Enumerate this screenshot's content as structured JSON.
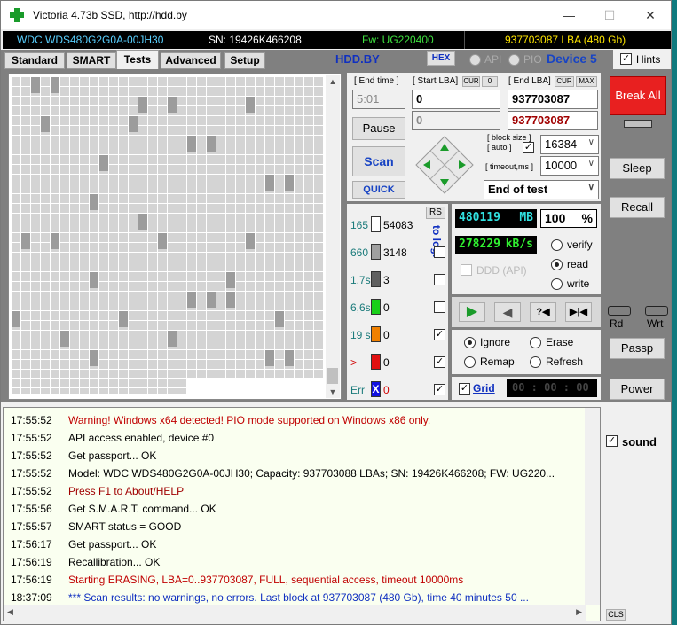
{
  "window": {
    "title": "Victoria 4.73b SSD, http://hdd.by",
    "minimize": "—",
    "maximize": "☐",
    "close": "✕"
  },
  "info": {
    "model": "WDC WDS480G2G0A-00JH30",
    "sn": "SN: 19426K466208",
    "fw": "Fw: UG220400",
    "lba": "937703087 LBA (480 Gb)"
  },
  "tabs": [
    "Standard",
    "SMART",
    "Tests",
    "Advanced",
    "Setup"
  ],
  "toolbar": {
    "hddby": "HDD.BY",
    "hex": "HEX",
    "api": "API",
    "pio": "PIO",
    "device": "Device 5",
    "hints": "Hints"
  },
  "scan": {
    "end_time_label": "[ End time ]",
    "end_time": "5:01",
    "start_lba_label": "[ Start LBA]",
    "cur": "CUR",
    "zero": "0",
    "start_lba": "0",
    "start_lba_current": "0",
    "end_lba_label": "[ End LBA]",
    "cur2": "CUR",
    "max": "MAX",
    "end_lba": "937703087",
    "end_lba_current": "937703087",
    "pause": "Pause",
    "scan": "Scan",
    "quick": "QUICK",
    "block_size_label": "[ block size ]",
    "auto_label": "[ auto ]",
    "block_size": "16384",
    "timeout_label": "[ timeout,ms ]",
    "timeout": "10000",
    "end_action": "End of test"
  },
  "stats": {
    "rs": "RS",
    "to_log": "to log:",
    "rows": [
      {
        "label": "165",
        "count": "54083",
        "color": "#ffffff"
      },
      {
        "label": "660",
        "count": "3148",
        "color": "#a0a0a0"
      },
      {
        "label": "1,7s",
        "count": "3",
        "color": "#606060"
      },
      {
        "label": "6,6s",
        "count": "0",
        "color": "#19d019"
      },
      {
        "label": "19 s",
        "count": "0",
        "color": "#f08000"
      },
      {
        "label": ">",
        "count": "0",
        "color": "#e01010"
      },
      {
        "label": "Err",
        "count": "0",
        "color": "#1010e0",
        "mark": "X"
      }
    ],
    "log_checks": [
      "",
      "",
      "",
      "✓",
      "✓",
      "✓"
    ]
  },
  "progress": {
    "mb": "480119",
    "mb_unit": "MB",
    "pct": "100",
    "pct_unit": "%",
    "speed": "278229",
    "speed_unit": "kB/s",
    "ddd": "DDD (API)",
    "verify": "verify",
    "read": "read",
    "write": "write"
  },
  "transport": {
    "play": "▶",
    "back": "◀",
    "help": "?◀",
    "skip": "▶|◀"
  },
  "actions": {
    "ignore": "Ignore",
    "erase": "Erase",
    "remap": "Remap",
    "refresh": "Refresh",
    "grid": "Grid",
    "timer": "00 : 00 : 00"
  },
  "side": {
    "break_all": "Break All",
    "sleep": "Sleep",
    "recall": "Recall",
    "rd": "Rd",
    "wrt": "Wrt",
    "passp": "Passp",
    "power": "Power",
    "sound": "sound",
    "cls": "CLS"
  },
  "log": [
    {
      "time": "17:55:52",
      "text": "Warning! Windows x64 detected! PIO mode supported on Windows x86 only.",
      "color": "#c00000"
    },
    {
      "time": "17:55:52",
      "text": "API access enabled, device #0",
      "color": "#000000"
    },
    {
      "time": "17:55:52",
      "text": "Get passport... OK",
      "color": "#000000"
    },
    {
      "time": "17:55:52",
      "text": "Model: WDC WDS480G2G0A-00JH30; Capacity: 937703088 LBAs; SN: 19426K466208; FW: UG220...",
      "color": "#000000"
    },
    {
      "time": "17:55:52",
      "text": "Press F1 to About/HELP",
      "color": "#a00000"
    },
    {
      "time": "17:55:56",
      "text": "Get S.M.A.R.T. command... OK",
      "color": "#000000"
    },
    {
      "time": "17:55:57",
      "text": "SMART status = GOOD",
      "color": "#000000"
    },
    {
      "time": "17:56:17",
      "text": "Get passport... OK",
      "color": "#000000"
    },
    {
      "time": "17:56:19",
      "text": "Recallibration... OK",
      "color": "#000000"
    },
    {
      "time": "17:56:19",
      "text": "Starting ERASING, LBA=0..937703087, FULL, sequential access, timeout 10000ms",
      "color": "#c00000"
    },
    {
      "time": "18:37:09",
      "text": "*** Scan results: no warnings, no errors. Last block at 937703087 (480 Gb), time 40 minutes 50 ...",
      "color": "#1030c0"
    }
  ]
}
